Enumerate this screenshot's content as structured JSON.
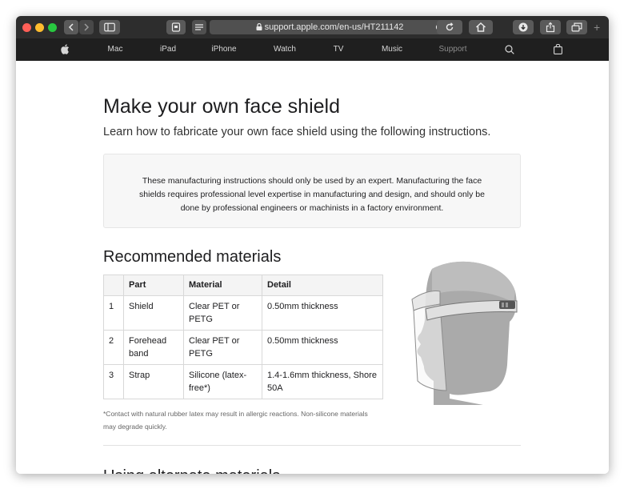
{
  "browser": {
    "url": "support.apple.com/en-us/HT211142"
  },
  "globalnav": {
    "items": [
      "Mac",
      "iPad",
      "iPhone",
      "Watch",
      "TV",
      "Music",
      "Support"
    ]
  },
  "page": {
    "title": "Make your own face shield",
    "intro": "Learn how to fabricate your own face shield using the following instructions.",
    "note": "These manufacturing instructions should only be used by an expert. Manufacturing the face shields requires professional level expertise in manufacturing and design, and should only be done by professional engineers or machinists in a factory environment.",
    "section_title": "Recommended materials",
    "table": {
      "headers": [
        "",
        "Part",
        "Material",
        "Detail"
      ],
      "rows": [
        [
          "1",
          "Shield",
          "Clear PET or PETG",
          "0.50mm thickness"
        ],
        [
          "2",
          "Forehead band",
          "Clear PET or PETG",
          "0.50mm thickness"
        ],
        [
          "3",
          "Strap",
          "Silicone (latex-free*)",
          "1.4-1.6mm thickness, Shore 50A"
        ]
      ]
    },
    "footnote": "*Contact with natural rubber latex may result in allergic reactions. Non-silicone materials may degrade quickly.",
    "next_heading": "Using alternate materials"
  },
  "icons": {
    "apple": "apple-logo-icon",
    "search": "search-icon",
    "bag": "bag-icon"
  }
}
